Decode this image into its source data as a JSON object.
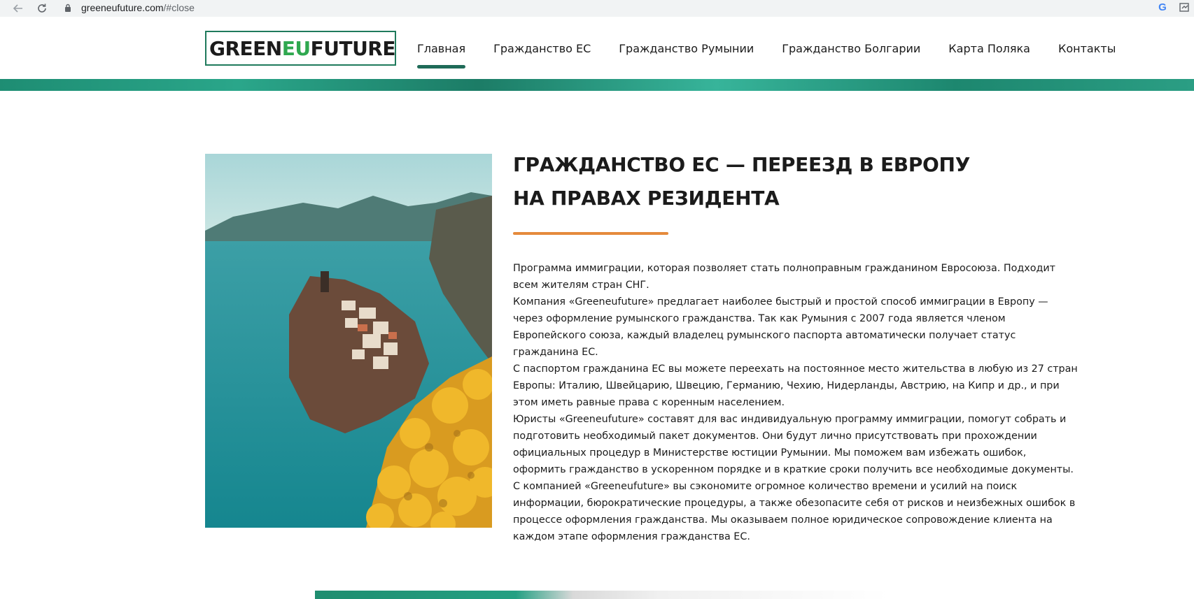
{
  "browser": {
    "url_host": "greeneufuture.com",
    "url_path": "/#close"
  },
  "logo": {
    "text_left": "GREEN",
    "text_mid": "EU",
    "text_right": "FUTURE"
  },
  "nav": {
    "items": [
      {
        "label": "Главная",
        "active": true
      },
      {
        "label": "Гражданство ЕС",
        "active": false
      },
      {
        "label": "Гражданство Румынии",
        "active": false
      },
      {
        "label": "Гражданство Болгарии",
        "active": false
      },
      {
        "label": "Карта Поляка",
        "active": false
      },
      {
        "label": "Контакты",
        "active": false
      }
    ]
  },
  "main": {
    "heading_line1": "ГРАЖДАНСТВО ЕС — ПЕРЕЕЗД В ЕВРОПУ",
    "heading_line2": "НА ПРАВАХ РЕЗИДЕНТА",
    "paragraphs": [
      "Программа иммиграции, которая позволяет стать полноправным гражданином Евросоюза. Подходит всем жителям стран СНГ.",
      "Компания «Greeneufuture» предлагает наиболее быстрый и простой способ иммиграции в Европу — через оформление румынского гражданства. Так как Румыния с 2007 года является членом Европейского союза, каждый владелец румынского паспорта автоматически получает статус гражданина ЕС.",
      "С паспортом гражданина ЕС вы можете переехать на постоянное место жительства в любую из 27 стран Европы: Италию, Швейцарию, Швецию, Германию, Чехию, Нидерланды, Австрию, на Кипр и др., и при этом иметь равные права с коренным населением.",
      "Юристы «Greeneufuture» составят для вас индивидуальную программу иммиграции, помогут собрать и подготовить необходимый пакет документов. Они будут лично присутствовать при прохождении официальных процедур в Министерстве юстиции Румынии. Мы поможем вам избежать ошибок, оформить гражданство в ускоренном порядке и в краткие сроки получить все необходимые документы.",
      "С компанией «Greeneufuture» вы сэкономите огромное количество времени и усилий на поиск информации, бюрократические процедуры, а также обезопасите себя от рисков и неизбежных ошибок в процессе оформления гражданства. Мы оказываем полное юридическое сопровождение клиента на каждом этапе оформления гражданства ЕС."
    ]
  },
  "colors": {
    "brand_green": "#1f6b58",
    "accent_orange": "#e58a3c",
    "logo_eu_green": "#2fa84f"
  }
}
